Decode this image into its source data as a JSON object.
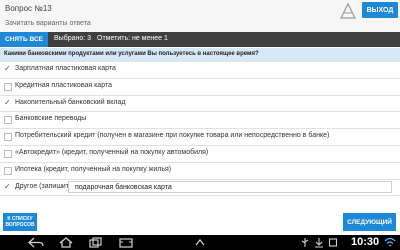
{
  "header": {
    "title": "Вопрос №13",
    "subtitle": "Зачитать варианты ответа",
    "exit_label": "ВЫХОД"
  },
  "toolbar": {
    "clear_label": "СНЯТЬ ВСЕ",
    "selected_text": "Выбрано: 3",
    "mark_min_text": "Отметить: не менее 1"
  },
  "question": {
    "text": "Какими банковскими продуктами или услугами Вы пользуетесь в настоящее время?"
  },
  "options": [
    {
      "label": "Зарплатная пластиковая карта",
      "checked": true
    },
    {
      "label": "Кредитная пластиковая карта",
      "checked": false
    },
    {
      "label": "Накопительный банковский вклад",
      "checked": true
    },
    {
      "label": "Банковские переводы",
      "checked": false
    },
    {
      "label": "Потребительский кредит (получен в магазине при покупке товара или непосредственно в банке)",
      "checked": false
    },
    {
      "label": "«Автокредит» (кредит, полученный на покупку автомобиля)",
      "checked": false
    },
    {
      "label": "Ипотека (кредит, полученный на покупку жилья)",
      "checked": false
    },
    {
      "label": "Другое (запишите)",
      "checked": true,
      "input_value": "подарочная банковская карта"
    }
  ],
  "footer": {
    "back_label": "К СПИСКУ ВОПРОСОВ",
    "next_label": "СЛЕДУЮЩИЙ"
  },
  "statusbar": {
    "time": "10:30"
  },
  "colors": {
    "accent": "#1e88d6",
    "toolbar_bg": "#404040",
    "question_band_bg": "#d6e7f5"
  }
}
